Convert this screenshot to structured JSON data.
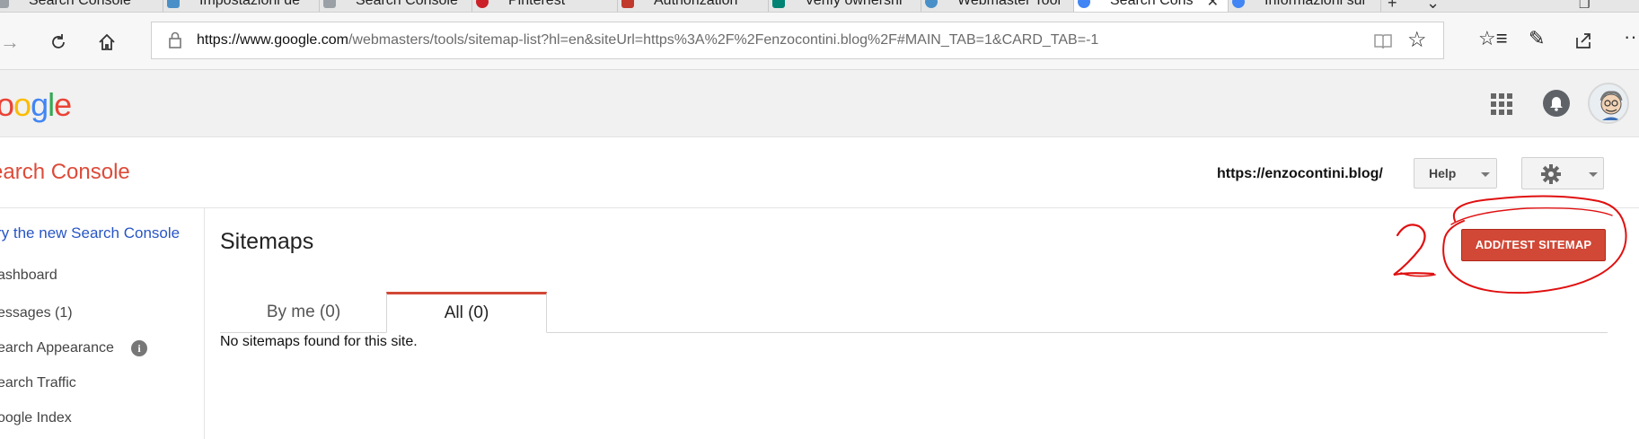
{
  "browser": {
    "tabs": [
      {
        "title": "Search Console",
        "icon": "search-console-favicon"
      },
      {
        "title": "Impostazioni de",
        "icon": "wordpress-favicon"
      },
      {
        "title": "Search Console",
        "icon": "search-console-favicon"
      },
      {
        "title": "Pinterest",
        "icon": "pinterest-favicon"
      },
      {
        "title": "Authorization",
        "icon": "authorization-favicon"
      },
      {
        "title": "Verify ownershi",
        "icon": "bing-favicon"
      },
      {
        "title": "Webmaster Tool",
        "icon": "wordpress-favicon"
      },
      {
        "title": "Search Cons",
        "icon": "google-favicon",
        "active": true
      },
      {
        "title": "Informazioni sul",
        "icon": "google-favicon"
      }
    ],
    "url_domain": "https://www.google.com",
    "url_path": "/webmasters/tools/sitemap-list?hl=en&siteUrl=https%3A%2F%2Fenzocontini.blog%2F#MAIN_TAB=1&CARD_TAB=-1"
  },
  "google": {
    "logo": [
      "o",
      "o",
      "g",
      "l",
      "e"
    ],
    "logo_colors": [
      "#EA4335",
      "#FBBC05",
      "#4285F4",
      "#34A853",
      "#EA4335"
    ]
  },
  "console": {
    "title": "earch Console",
    "site_url": "https://enzocontini.blog/",
    "help_label": "Help"
  },
  "sidebar": {
    "new_console_link": "ry the new Search Console",
    "items": [
      {
        "label": "ashboard"
      },
      {
        "label": "essages (1)"
      },
      {
        "label": "earch Appearance"
      },
      {
        "label": "earch Traffic"
      },
      {
        "label": "oogle Index"
      }
    ]
  },
  "main": {
    "title": "Sitemaps",
    "add_button": "ADD/TEST SITEMAP",
    "tabs": [
      {
        "label": "By me (0)",
        "active": false
      },
      {
        "label": "All (0)",
        "active": true
      }
    ],
    "empty_message": "No sitemaps found for this site."
  },
  "colors": {
    "accent_red": "#d14836",
    "console_title": "#dd4b39",
    "link_blue": "#2855c5",
    "annotation_red": "#e01010"
  }
}
